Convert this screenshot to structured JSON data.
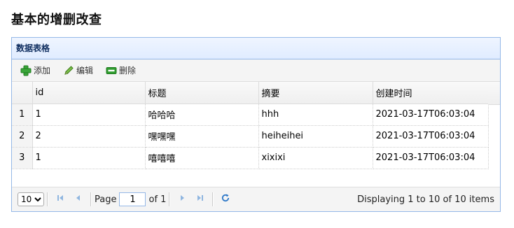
{
  "page": {
    "title": "基本的增删改查"
  },
  "panel": {
    "title": "数据表格"
  },
  "toolbar": {
    "add_label": "添加",
    "edit_label": "编辑",
    "delete_label": "删除"
  },
  "table": {
    "columns": [
      "id",
      "标题",
      "摘要",
      "创建时间"
    ],
    "rows": [
      {
        "rownum": "1",
        "id": "1",
        "title": "哈哈哈",
        "summary": "hhh",
        "created": "2021-03-17T06:03:04"
      },
      {
        "rownum": "2",
        "id": "2",
        "title": "嘿嘿嘿",
        "summary": "heiheihei",
        "created": "2021-03-17T06:03:04"
      },
      {
        "rownum": "3",
        "id": "1",
        "title": "嘻嘻嘻",
        "summary": "xixixi",
        "created": "2021-03-17T06:03:04"
      }
    ]
  },
  "pager": {
    "page_size": "10",
    "page_label": "Page",
    "current_page": "1",
    "of_label": "of 1",
    "info": "Displaying 1 to 10 of 10 items"
  },
  "colors": {
    "border": "#95b8e7",
    "header_text": "#0e2d5f",
    "icon_blue": "#6e9fd2",
    "add_green": "#2f9c2f"
  }
}
